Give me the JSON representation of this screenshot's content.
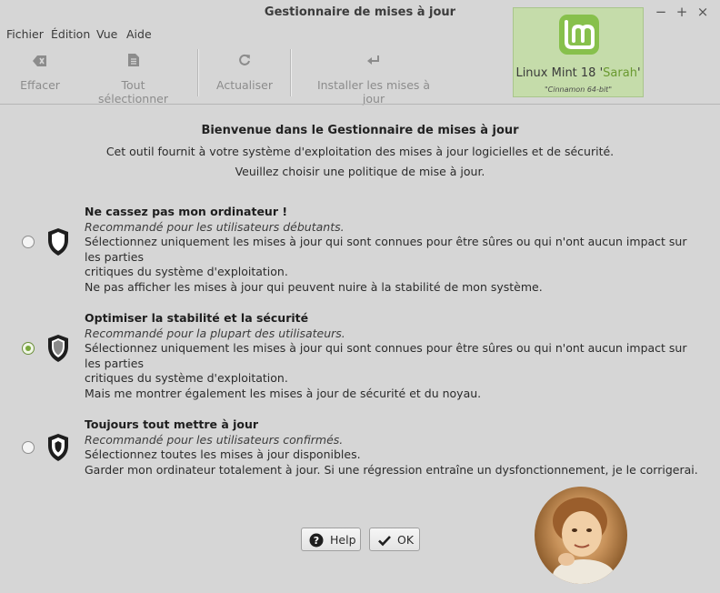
{
  "window": {
    "title": "Gestionnaire de mises à jour",
    "controls": [
      "−",
      "+",
      "×"
    ]
  },
  "menu": [
    "Fichier",
    "Édition",
    "Vue",
    "Aide"
  ],
  "toolbar": {
    "clear": "Effacer",
    "select_all": "Tout sélectionner",
    "refresh": "Actualiser",
    "install": "Installer les mises à jour"
  },
  "logo": {
    "name_prefix": "Linux Mint 18 '",
    "name_codename": "Sarah",
    "name_suffix": "'",
    "edition": "\"Cinnamon 64-bit\""
  },
  "welcome": {
    "title": "Bienvenue dans le Gestionnaire de mises à jour",
    "line1": "Cet outil fournit à votre système d'exploitation des mises à jour logicielles et de sécurité.",
    "line2": "Veuillez choisir une politique de mise à jour."
  },
  "options": [
    {
      "title": "Ne cassez pas mon ordinateur !",
      "recommendation": "Recommandé pour les utilisateurs débutants.",
      "line1": "Sélectionnez uniquement les mises à jour qui sont connues pour être sûres ou qui n'ont aucun impact sur les parties",
      "line2": "critiques du système d'exploitation.",
      "line3": "Ne pas afficher les mises à jour qui peuvent nuire à la stabilité de mon système.",
      "selected": false
    },
    {
      "title": "Optimiser la stabilité et la sécurité",
      "recommendation": "Recommandé pour la plupart des utilisateurs.",
      "line1": "Sélectionnez uniquement les mises à jour qui sont connues pour être sûres ou qui n'ont aucun impact sur les parties",
      "line2": "critiques du système d'exploitation.",
      "line3": "Mais me montrer également les mises à jour de sécurité et du noyau.",
      "selected": true
    },
    {
      "title": "Toujours tout mettre à jour",
      "recommendation": "Recommandé pour les utilisateurs confirmés.",
      "line1": "Sélectionnez toutes les mises à jour disponibles.",
      "line2": "Garder mon ordinateur totalement à jour. Si une régression entraîne un dysfonctionnement, je le corrigerai.",
      "selected": false
    }
  ],
  "buttons": {
    "help": "Help",
    "ok": "OK"
  },
  "colors": {
    "accent": "#78a83b",
    "logo_bg": "#c5dcaa"
  }
}
